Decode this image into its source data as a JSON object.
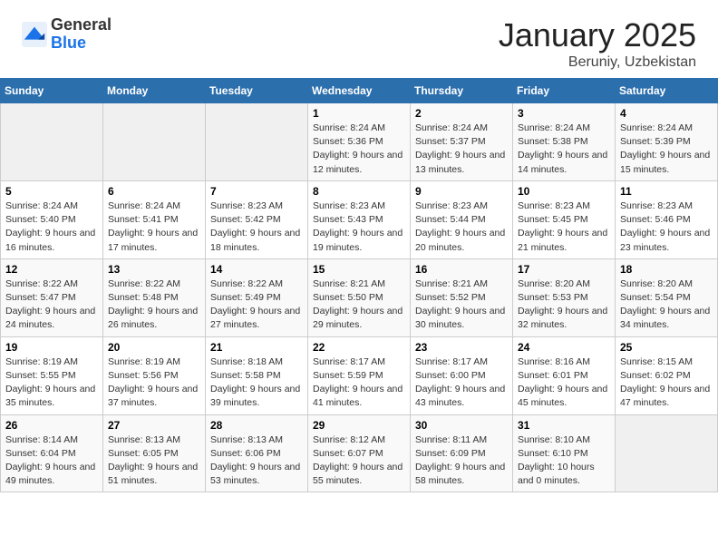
{
  "header": {
    "logo_general": "General",
    "logo_blue": "Blue",
    "title": "January 2025",
    "subtitle": "Beruniy, Uzbekistan"
  },
  "weekdays": [
    "Sunday",
    "Monday",
    "Tuesday",
    "Wednesday",
    "Thursday",
    "Friday",
    "Saturday"
  ],
  "weeks": [
    [
      {
        "day": "",
        "info": ""
      },
      {
        "day": "",
        "info": ""
      },
      {
        "day": "",
        "info": ""
      },
      {
        "day": "1",
        "info": "Sunrise: 8:24 AM\nSunset: 5:36 PM\nDaylight: 9 hours and 12 minutes."
      },
      {
        "day": "2",
        "info": "Sunrise: 8:24 AM\nSunset: 5:37 PM\nDaylight: 9 hours and 13 minutes."
      },
      {
        "day": "3",
        "info": "Sunrise: 8:24 AM\nSunset: 5:38 PM\nDaylight: 9 hours and 14 minutes."
      },
      {
        "day": "4",
        "info": "Sunrise: 8:24 AM\nSunset: 5:39 PM\nDaylight: 9 hours and 15 minutes."
      }
    ],
    [
      {
        "day": "5",
        "info": "Sunrise: 8:24 AM\nSunset: 5:40 PM\nDaylight: 9 hours and 16 minutes."
      },
      {
        "day": "6",
        "info": "Sunrise: 8:24 AM\nSunset: 5:41 PM\nDaylight: 9 hours and 17 minutes."
      },
      {
        "day": "7",
        "info": "Sunrise: 8:23 AM\nSunset: 5:42 PM\nDaylight: 9 hours and 18 minutes."
      },
      {
        "day": "8",
        "info": "Sunrise: 8:23 AM\nSunset: 5:43 PM\nDaylight: 9 hours and 19 minutes."
      },
      {
        "day": "9",
        "info": "Sunrise: 8:23 AM\nSunset: 5:44 PM\nDaylight: 9 hours and 20 minutes."
      },
      {
        "day": "10",
        "info": "Sunrise: 8:23 AM\nSunset: 5:45 PM\nDaylight: 9 hours and 21 minutes."
      },
      {
        "day": "11",
        "info": "Sunrise: 8:23 AM\nSunset: 5:46 PM\nDaylight: 9 hours and 23 minutes."
      }
    ],
    [
      {
        "day": "12",
        "info": "Sunrise: 8:22 AM\nSunset: 5:47 PM\nDaylight: 9 hours and 24 minutes."
      },
      {
        "day": "13",
        "info": "Sunrise: 8:22 AM\nSunset: 5:48 PM\nDaylight: 9 hours and 26 minutes."
      },
      {
        "day": "14",
        "info": "Sunrise: 8:22 AM\nSunset: 5:49 PM\nDaylight: 9 hours and 27 minutes."
      },
      {
        "day": "15",
        "info": "Sunrise: 8:21 AM\nSunset: 5:50 PM\nDaylight: 9 hours and 29 minutes."
      },
      {
        "day": "16",
        "info": "Sunrise: 8:21 AM\nSunset: 5:52 PM\nDaylight: 9 hours and 30 minutes."
      },
      {
        "day": "17",
        "info": "Sunrise: 8:20 AM\nSunset: 5:53 PM\nDaylight: 9 hours and 32 minutes."
      },
      {
        "day": "18",
        "info": "Sunrise: 8:20 AM\nSunset: 5:54 PM\nDaylight: 9 hours and 34 minutes."
      }
    ],
    [
      {
        "day": "19",
        "info": "Sunrise: 8:19 AM\nSunset: 5:55 PM\nDaylight: 9 hours and 35 minutes."
      },
      {
        "day": "20",
        "info": "Sunrise: 8:19 AM\nSunset: 5:56 PM\nDaylight: 9 hours and 37 minutes."
      },
      {
        "day": "21",
        "info": "Sunrise: 8:18 AM\nSunset: 5:58 PM\nDaylight: 9 hours and 39 minutes."
      },
      {
        "day": "22",
        "info": "Sunrise: 8:17 AM\nSunset: 5:59 PM\nDaylight: 9 hours and 41 minutes."
      },
      {
        "day": "23",
        "info": "Sunrise: 8:17 AM\nSunset: 6:00 PM\nDaylight: 9 hours and 43 minutes."
      },
      {
        "day": "24",
        "info": "Sunrise: 8:16 AM\nSunset: 6:01 PM\nDaylight: 9 hours and 45 minutes."
      },
      {
        "day": "25",
        "info": "Sunrise: 8:15 AM\nSunset: 6:02 PM\nDaylight: 9 hours and 47 minutes."
      }
    ],
    [
      {
        "day": "26",
        "info": "Sunrise: 8:14 AM\nSunset: 6:04 PM\nDaylight: 9 hours and 49 minutes."
      },
      {
        "day": "27",
        "info": "Sunrise: 8:13 AM\nSunset: 6:05 PM\nDaylight: 9 hours and 51 minutes."
      },
      {
        "day": "28",
        "info": "Sunrise: 8:13 AM\nSunset: 6:06 PM\nDaylight: 9 hours and 53 minutes."
      },
      {
        "day": "29",
        "info": "Sunrise: 8:12 AM\nSunset: 6:07 PM\nDaylight: 9 hours and 55 minutes."
      },
      {
        "day": "30",
        "info": "Sunrise: 8:11 AM\nSunset: 6:09 PM\nDaylight: 9 hours and 58 minutes."
      },
      {
        "day": "31",
        "info": "Sunrise: 8:10 AM\nSunset: 6:10 PM\nDaylight: 10 hours and 0 minutes."
      },
      {
        "day": "",
        "info": ""
      }
    ]
  ]
}
